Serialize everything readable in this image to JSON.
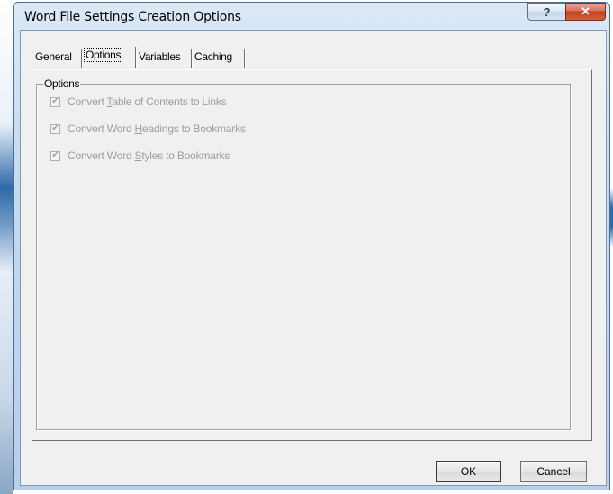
{
  "window": {
    "title": "Word File Settings Creation Options",
    "help_glyph": "?",
    "close_glyph": "✕"
  },
  "tabs": [
    {
      "label": "General",
      "active": false
    },
    {
      "label": "Options",
      "active": true
    },
    {
      "label": "Variables",
      "active": false
    },
    {
      "label": "Caching",
      "active": false
    }
  ],
  "options_group": {
    "label": "Options",
    "checkboxes": [
      {
        "pre": "Convert ",
        "mnemonic": "T",
        "post": "able of Contents to Links",
        "checked": true,
        "enabled": false
      },
      {
        "pre": "Convert Word ",
        "mnemonic": "H",
        "post": "eadings to Bookmarks",
        "checked": true,
        "enabled": false
      },
      {
        "pre": "Convert Word ",
        "mnemonic": "S",
        "post": "tyles to Bookmarks",
        "checked": true,
        "enabled": false
      }
    ]
  },
  "buttons": {
    "ok": "OK",
    "cancel": "Cancel"
  },
  "colors": {
    "disabled_text": "#9d9d9d",
    "dialog_bg": "#f0f0f0",
    "frame_blue": "#c5d8ee",
    "close_red": "#c3411f"
  },
  "icons": {
    "check": "✔"
  }
}
